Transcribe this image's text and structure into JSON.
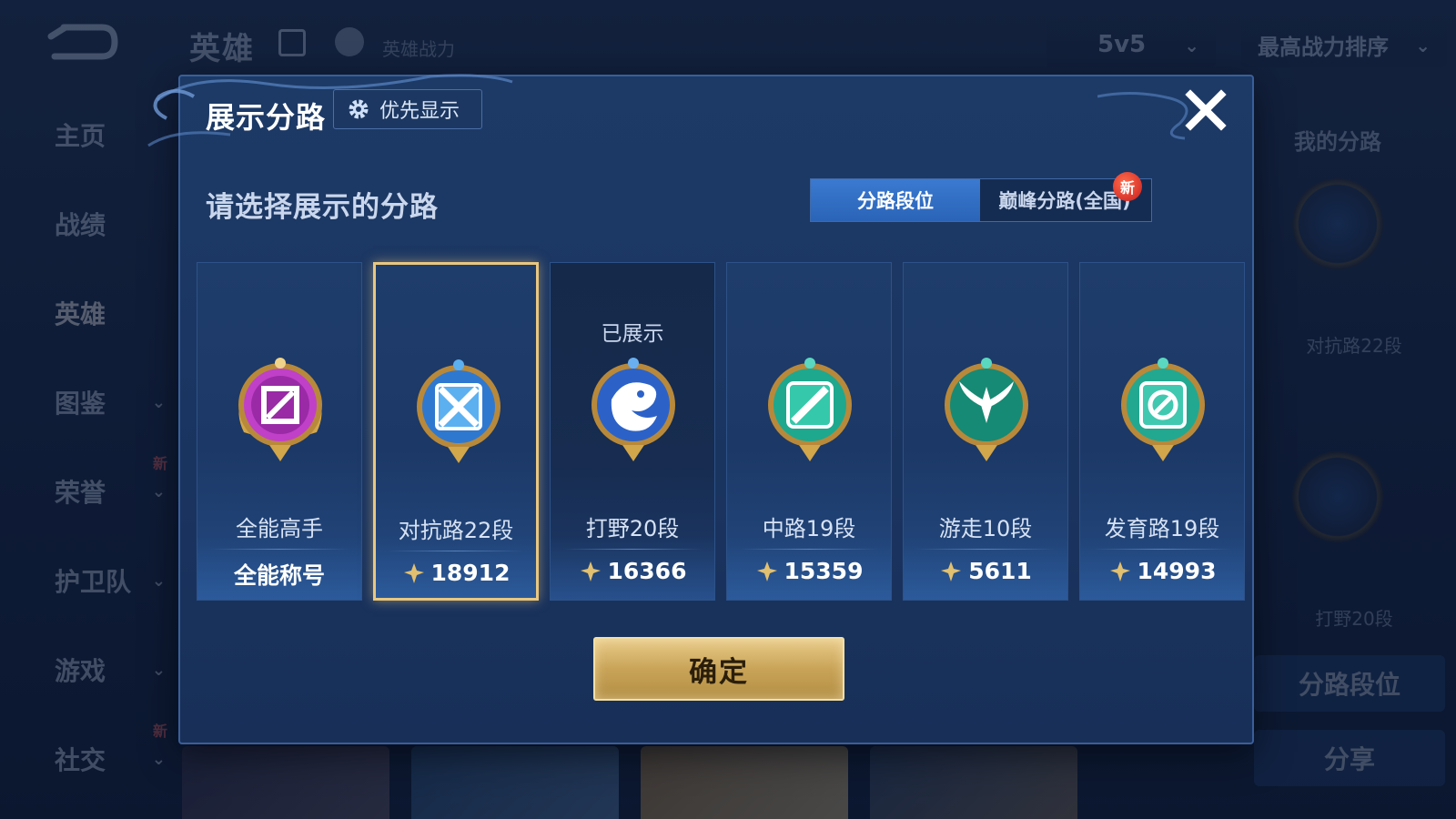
{
  "topbar": {
    "title": "英雄",
    "power_label": "英雄战力",
    "mode_select": "5v5",
    "sort_select": "最高战力排序"
  },
  "sidebar": {
    "items": [
      {
        "label": "主页",
        "has_chevron": false,
        "is_new": false
      },
      {
        "label": "战绩",
        "has_chevron": false,
        "is_new": false
      },
      {
        "label": "英雄",
        "has_chevron": false,
        "is_new": false,
        "active": true
      },
      {
        "label": "图鉴",
        "has_chevron": true,
        "is_new": false
      },
      {
        "label": "荣誉",
        "has_chevron": true,
        "is_new": true
      },
      {
        "label": "护卫队",
        "has_chevron": true,
        "is_new": false
      },
      {
        "label": "游戏",
        "has_chevron": true,
        "is_new": false
      },
      {
        "label": "社交",
        "has_chevron": true,
        "is_new": true
      }
    ],
    "new_badge": "新"
  },
  "right_panel": {
    "title": "我的分路",
    "lane1_label": "对抗路22段",
    "lane2_label": "打野20段",
    "lane_rank_button": "分路段位",
    "share_button": "分享"
  },
  "modal": {
    "title": "展示分路",
    "priority_button": "优先显示",
    "subtitle": "请选择展示的分路",
    "tabs": [
      {
        "label": "分路段位",
        "active": true
      },
      {
        "label": "巅峰分路(全国)",
        "active": false,
        "badge": "新"
      }
    ],
    "shown_label": "已展示",
    "cards": [
      {
        "label": "全能高手",
        "value": "全能称号",
        "badge_color": "#c040c8",
        "icon": "allround-icon",
        "selected": false,
        "shown": false,
        "has_power": false
      },
      {
        "label": "对抗路22段",
        "value": "18912",
        "badge_color": "#3a8ee0",
        "icon": "swords-icon",
        "selected": true,
        "shown": false,
        "has_power": true
      },
      {
        "label": "打野20段",
        "value": "16366",
        "badge_color": "#2c62c8",
        "icon": "dragon-icon",
        "selected": false,
        "shown": true,
        "has_power": true
      },
      {
        "label": "中路19段",
        "value": "15359",
        "badge_color": "#1ea88e",
        "icon": "staff-icon",
        "selected": false,
        "shown": false,
        "has_power": true
      },
      {
        "label": "游走10段",
        "value": "5611",
        "badge_color": "#168a74",
        "icon": "wings-icon",
        "selected": false,
        "shown": false,
        "has_power": true
      },
      {
        "label": "发育路19段",
        "value": "14993",
        "badge_color": "#22a890",
        "icon": "bow-icon",
        "selected": false,
        "shown": false,
        "has_power": true
      }
    ],
    "confirm_button": "确定"
  },
  "colors": {
    "accent_gold": "#e9c780",
    "tab_active": "#2a64b8",
    "modal_bg": "#1d3a66"
  }
}
